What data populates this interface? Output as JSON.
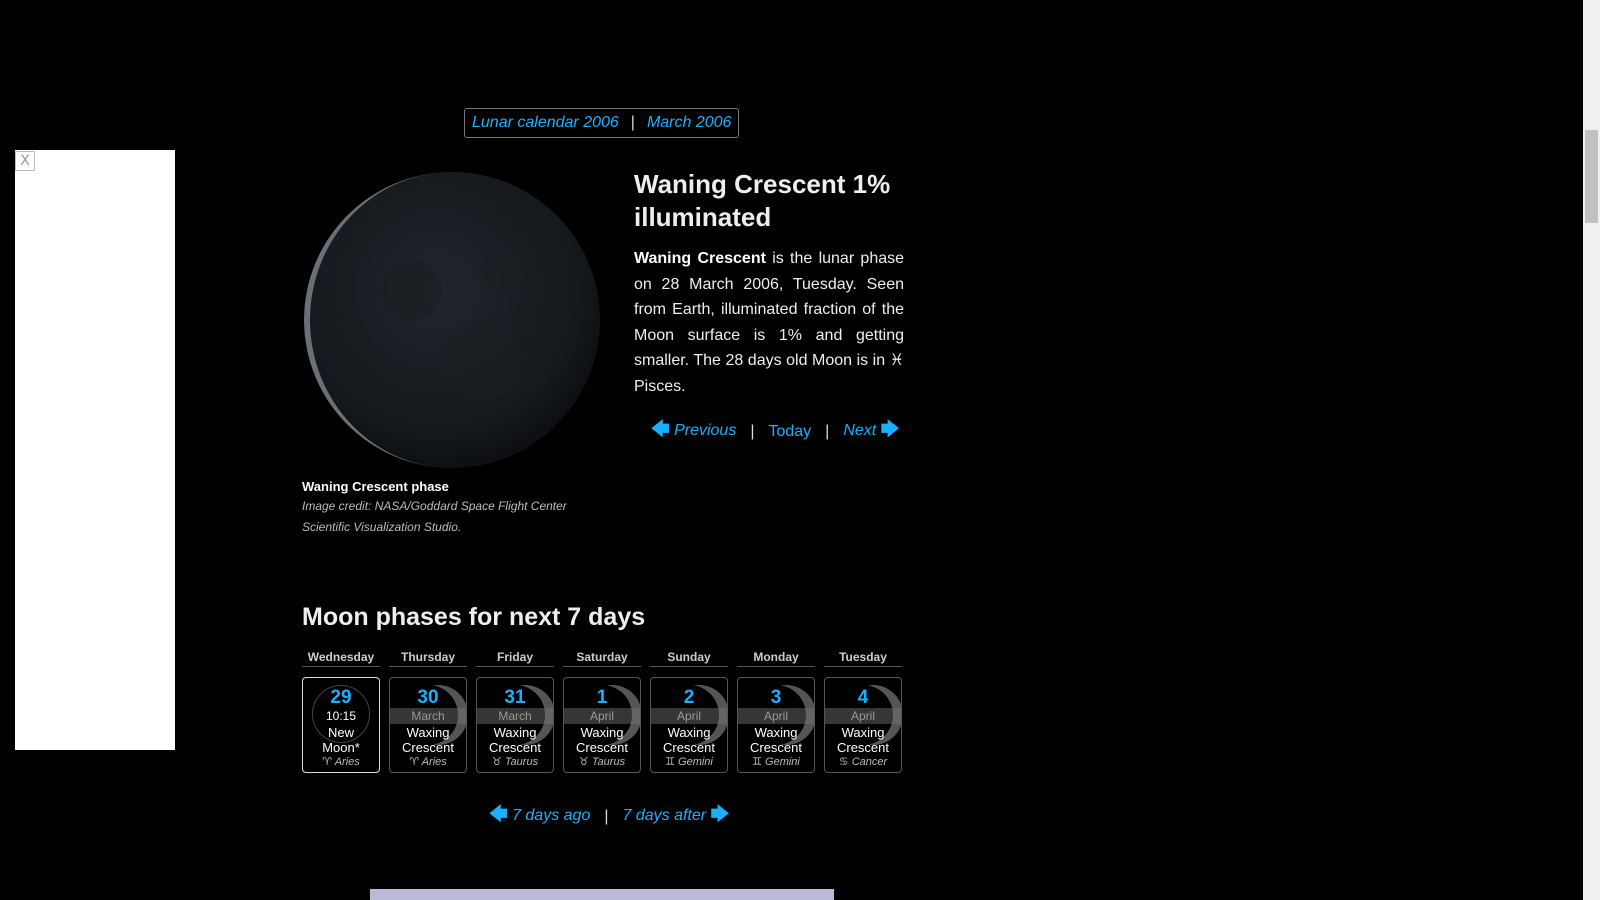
{
  "ad": {
    "close_label": "X"
  },
  "breadcrumb": {
    "calendar_link": "Lunar calendar 2006",
    "separator": "|",
    "month_link": "March 2006"
  },
  "moon_image": {
    "caption_title": "Waning Crescent phase",
    "caption_credit": "Image credit: NASA/Goddard Space Flight Center Scientific Visualization Studio."
  },
  "phase": {
    "title": "Waning Crescent 1% illuminated",
    "desc_bold": "Waning Crescent",
    "desc_part1": " is the lunar phase on 28 March 2006, Tuesday. Seen from Earth, illuminated fraction of the Moon surface is 1% and getting smaller. The 28 days old Moon is in ",
    "zodiac_symbol": "♓",
    "zodiac_name": " Pisces.",
    "illumination_percent": 1
  },
  "phase_nav": {
    "prev": "Previous",
    "today": "Today",
    "next": "Next",
    "separator": "|"
  },
  "next_days": {
    "heading": "Moon phases for next 7 days",
    "days": [
      {
        "weekday": "Wednesday",
        "num": "29",
        "month": "",
        "time": "10:15",
        "phase_line1": "New",
        "phase_line2": "Moon*",
        "zodiac": "♈ Aries"
      },
      {
        "weekday": "Thursday",
        "num": "30",
        "month": "March",
        "time": "",
        "phase_line1": "Waxing",
        "phase_line2": "Crescent",
        "zodiac": "♈ Aries"
      },
      {
        "weekday": "Friday",
        "num": "31",
        "month": "March",
        "time": "",
        "phase_line1": "Waxing",
        "phase_line2": "Crescent",
        "zodiac": "♉ Taurus"
      },
      {
        "weekday": "Saturday",
        "num": "1",
        "month": "April",
        "time": "",
        "phase_line1": "Waxing",
        "phase_line2": "Crescent",
        "zodiac": "♉ Taurus"
      },
      {
        "weekday": "Sunday",
        "num": "2",
        "month": "April",
        "time": "",
        "phase_line1": "Waxing",
        "phase_line2": "Crescent",
        "zodiac": "♊ Gemini"
      },
      {
        "weekday": "Monday",
        "num": "3",
        "month": "April",
        "time": "",
        "phase_line1": "Waxing",
        "phase_line2": "Crescent",
        "zodiac": "♊ Gemini"
      },
      {
        "weekday": "Tuesday",
        "num": "4",
        "month": "April",
        "time": "",
        "phase_line1": "Waxing",
        "phase_line2": "Crescent",
        "zodiac": "♋ Cancer"
      }
    ]
  },
  "week_nav": {
    "prev": "7 days ago",
    "next": "7 days after",
    "separator": "|"
  },
  "icons": {
    "prev_arrow": "arrow-left-icon",
    "next_arrow": "arrow-right-icon"
  },
  "colors": {
    "link": "#1ab0ff",
    "background": "#000000"
  }
}
